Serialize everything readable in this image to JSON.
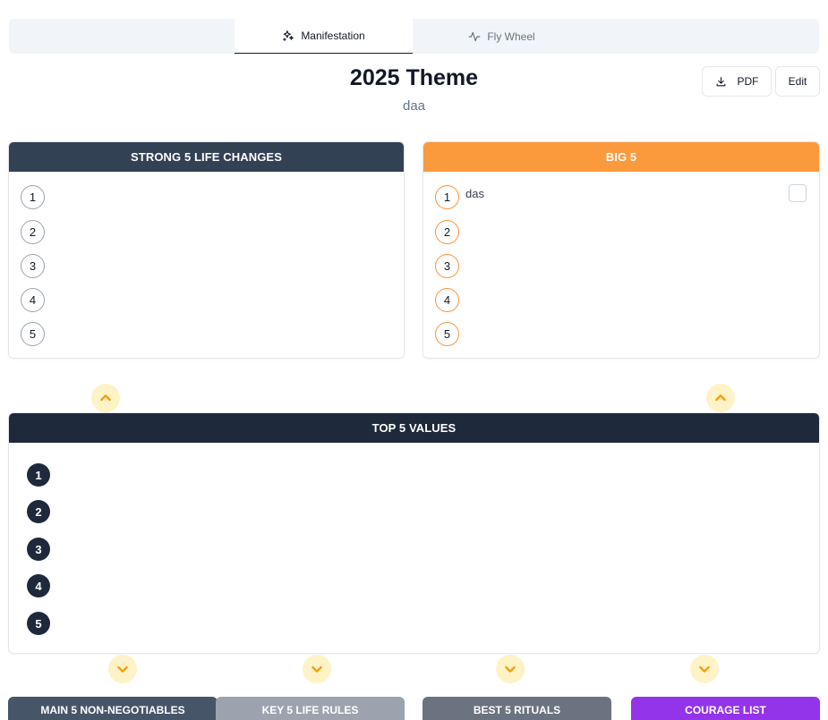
{
  "tabs": [
    {
      "label": "Manifestation",
      "icon": "sparkles-icon",
      "active": true
    },
    {
      "label": "Fly Wheel",
      "icon": "activity-icon",
      "active": false
    }
  ],
  "header": {
    "title": "2025 Theme",
    "subtitle": "daa",
    "pdf_label": "PDF",
    "edit_label": "Edit"
  },
  "strong5": {
    "title": "STRONG 5 LIFE CHANGES",
    "items": [
      {
        "n": "1",
        "text": ""
      },
      {
        "n": "2",
        "text": ""
      },
      {
        "n": "3",
        "text": ""
      },
      {
        "n": "4",
        "text": ""
      },
      {
        "n": "5",
        "text": ""
      }
    ]
  },
  "big5": {
    "title": "BIG 5",
    "items": [
      {
        "n": "1",
        "text": "das"
      },
      {
        "n": "2",
        "text": ""
      },
      {
        "n": "3",
        "text": ""
      },
      {
        "n": "4",
        "text": ""
      },
      {
        "n": "5",
        "text": ""
      }
    ]
  },
  "top5": {
    "title": "TOP 5 VALUES",
    "items": [
      {
        "n": "1"
      },
      {
        "n": "2"
      },
      {
        "n": "3"
      },
      {
        "n": "4"
      },
      {
        "n": "5"
      }
    ]
  },
  "bottom_tabs": [
    {
      "label": "MAIN 5 NON-NEGOTIABLES"
    },
    {
      "label": "KEY 5 LIFE RULES"
    },
    {
      "label": "BEST 5 RITUALS"
    },
    {
      "label": "COURAGE LIST"
    }
  ],
  "colors": {
    "accent_orange": "#fb9a3c",
    "arrow_color": "#f59e0b",
    "dark_header": "#1e293b",
    "slate_header": "#334155",
    "courage_purple": "#9333ea"
  }
}
